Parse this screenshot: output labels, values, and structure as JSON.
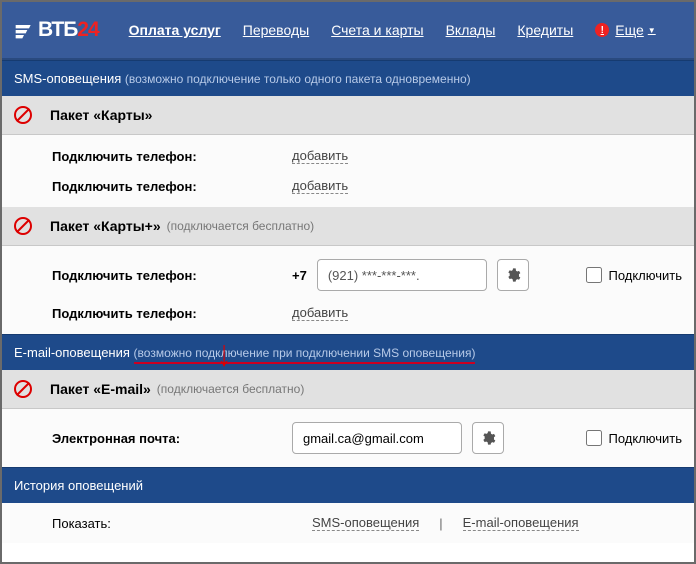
{
  "header": {
    "logo_main": "ВТБ",
    "logo_sub": "24",
    "nav": {
      "payments": "Оплата услуг",
      "transfers": "Переводы",
      "accounts": "Счета и карты",
      "deposits": "Вклады",
      "credits": "Кредиты",
      "more": "Еще",
      "alert": "!"
    }
  },
  "sms_section": {
    "title": "SMS-оповещения",
    "note": "(возможно подключение только одного пакета одновременно)"
  },
  "pkg_cards": {
    "title": "Пакет «Карты»",
    "row1_label": "Подключить телефон:",
    "row1_action": "добавить",
    "row2_label": "Подключить телефон:",
    "row2_action": "добавить"
  },
  "pkg_cardsplus": {
    "title": "Пакет «Карты+»",
    "note": "(подключается бесплатно)",
    "row1_label": "Подключить телефон:",
    "prefix": "+7",
    "phone_value": "(921) ***-***-***.",
    "row2_label": "Подключить телефон:",
    "row2_action": "добавить",
    "connect_label": "Подключить"
  },
  "email_section": {
    "title": "E-mail-оповещения",
    "note": "(возможно подключение при подключении SMS оповещения)"
  },
  "pkg_email": {
    "title": "Пакет «E-mail»",
    "note": "(подключается бесплатно)",
    "row1_label": "Электронная почта:",
    "email_value": "gmail.ca@gmail.com",
    "connect_label": "Подключить"
  },
  "history": {
    "title": "История оповещений",
    "show_label": "Показать:",
    "sms_link": "SMS-оповещения",
    "email_link": "E-mail-оповещения"
  }
}
